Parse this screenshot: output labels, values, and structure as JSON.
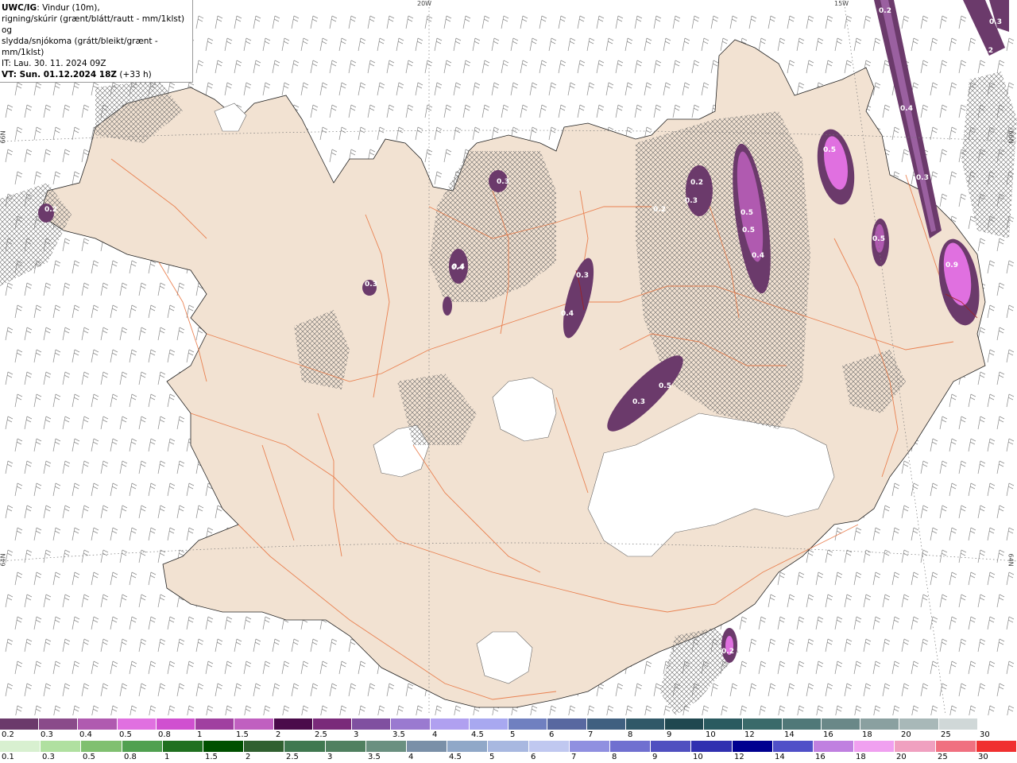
{
  "header": {
    "model": "UWC/IG",
    "line1_rest": ": Vindur (10m),",
    "line2": "rigning/skúrir (grænt/blátt/rautt - mm/1klst) og",
    "line3": "slydda/snjókoma (grátt/bleikt/grænt - mm/1klst)",
    "line4": "IT: Lau. 30. 11. 2024 09Z",
    "line5_bold": "VT: Sun. 01.12.2024 18Z",
    "line5_rest": " (+33 h)"
  },
  "graticule": {
    "top_20w": "20W",
    "top_15w": "15W",
    "left_66n": "66N",
    "left_64n": "64N",
    "right_66n": "66N",
    "right_64n": "64N"
  },
  "snow_labels": [
    "0.2",
    "0.3",
    "0.4",
    "0.3",
    "0.3",
    "0.4",
    "0.2",
    "0.3",
    "0.2",
    "0.5",
    "0.5",
    "0.4",
    "0.5",
    "0.5",
    "0.9",
    "0.4",
    "0.3",
    "0.2",
    "0.4",
    "0.3",
    "0.5",
    "0.2",
    "0.3",
    "0.2"
  ],
  "legend_snow": {
    "labels": [
      "0.2",
      "0.3",
      "0.4",
      "0.5",
      "0.8",
      "1",
      "1.5",
      "2",
      "2.5",
      "3",
      "3.5",
      "4",
      "4.5",
      "5",
      "6",
      "7",
      "8",
      "9",
      "10",
      "12",
      "14",
      "16",
      "18",
      "20",
      "25",
      "30"
    ],
    "colors": [
      "#6b3a6b",
      "#8a4b8a",
      "#b05ab0",
      "#e070e0",
      "#d050d0",
      "#a040a0",
      "#c060c0",
      "#4a0a4a",
      "#7a2a7a",
      "#8050a0",
      "#9a7ad0",
      "#b0a0f0",
      "#a8a8f0",
      "#7080c0",
      "#5868a0",
      "#406080",
      "#305868",
      "#204850",
      "#2a5a60",
      "#3a6a6a",
      "#507878",
      "#6a8888",
      "#8aa0a0",
      "#a8b8b8",
      "#d0d8d8",
      "#ffffff"
    ]
  },
  "legend_rain": {
    "labels": [
      "0.1",
      "0.3",
      "0.5",
      "0.8",
      "1",
      "1.5",
      "2",
      "2.5",
      "3",
      "3.5",
      "4",
      "4.5",
      "5",
      "6",
      "7",
      "8",
      "9",
      "10",
      "12",
      "14",
      "16",
      "18",
      "20",
      "25",
      "30"
    ],
    "colors": [
      "#d8f0d0",
      "#b0e0a0",
      "#80c070",
      "#50a050",
      "#207020",
      "#005000",
      "#306030",
      "#407850",
      "#508060",
      "#6a9080",
      "#7a90a8",
      "#90a8c8",
      "#a8b8e0",
      "#c0c8f0",
      "#9090e0",
      "#7070d0",
      "#5050c0",
      "#3030b0",
      "#000090",
      "#5050c8",
      "#c080e0",
      "#f0a0f0",
      "#f0a0c0",
      "#f07080",
      "#f03030"
    ]
  }
}
